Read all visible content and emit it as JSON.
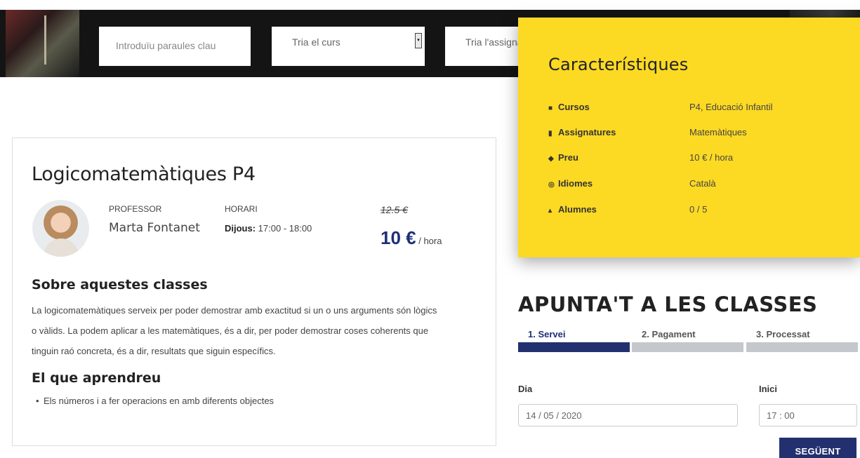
{
  "header": {
    "search_placeholder": "Introduïu paraules clau",
    "course_select": "Tria el curs",
    "subject_select": "Tria l'assignatura"
  },
  "features": {
    "title": "Característiques",
    "rows": [
      {
        "icon": "briefcase-icon",
        "label": "Cursos",
        "value": "P4, Educació Infantil"
      },
      {
        "icon": "book-icon",
        "label": "Assignatures",
        "value": "Matemàtiques"
      },
      {
        "icon": "tag-icon",
        "label": "Preu",
        "value": "10 € / hora"
      },
      {
        "icon": "globe-icon",
        "label": "Idiomes",
        "value": "Català"
      },
      {
        "icon": "user-icon",
        "label": "Alumnes",
        "value": "0 / 5"
      }
    ]
  },
  "class": {
    "title": "Logicomatemàtiques P4",
    "teacher_label": "PROFESSOR",
    "teacher_name": "Marta Fontanet",
    "schedule_label": "HORARI",
    "schedule_day": "Dijous:",
    "schedule_time": " 17:00 - 18:00",
    "old_price": "12.5 €",
    "price": "10 €",
    "price_unit": " / hora",
    "about_title": "Sobre aquestes classes",
    "about_lines": [
      "La logicomatemàtiques serveix per poder demostrar amb exactitud si un o uns arguments són lògics",
      "o vàlids. La podem aplicar a les matemàtiques, és a dir, per poder demostrar coses coherents que",
      "tinguin raó concreta, és a dir, resultats que siguin específics."
    ],
    "learn_title": "El que aprendreu",
    "learn_items": [
      "Els números i a fer operacions en amb diferents objectes"
    ]
  },
  "enroll": {
    "title": "APUNTA'T A LES CLASSES",
    "steps": [
      "1. Servei",
      "2. Pagament",
      "3. Processat"
    ],
    "active_step": 1,
    "day_label": "Dia",
    "day_value": "14 / 05 / 2020",
    "start_label": "Inici",
    "start_value": "17 : 00",
    "next_button": "SEGÜENT"
  },
  "colors": {
    "accent_navy": "#23306f",
    "panel_yellow": "#fcd923",
    "header_black": "#141414"
  }
}
